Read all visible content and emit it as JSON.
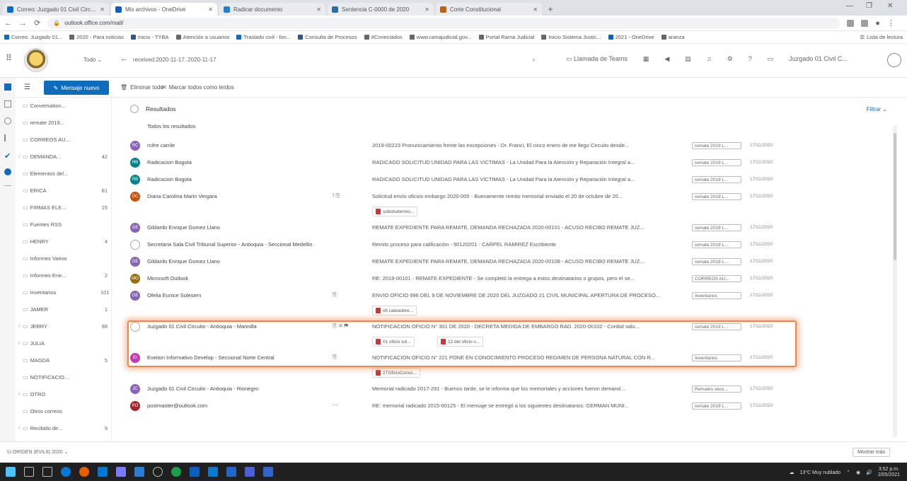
{
  "browser": {
    "tabs": [
      {
        "label": "Correo: Juzgado 01 Civil Circuito - A",
        "color": "#0f6cbd",
        "active": false
      },
      {
        "label": "Mis archivos - OneDrive",
        "color": "#0a5fbf",
        "active": true
      },
      {
        "label": "Radicar documento",
        "color": "#2b7cd3",
        "active": false
      },
      {
        "label": "Sentencia C-0000 de 2020",
        "color": "#2b6cb0",
        "active": false
      },
      {
        "label": "Corte Constitucional",
        "color": "#b5651d",
        "active": false
      }
    ],
    "new_tab": "+",
    "url": "outlook.office.com/mail/",
    "bookmarks": [
      {
        "label": "Correo: Juzgado 01...",
        "color": "#0f6cbd"
      },
      {
        "label": "2020 - Para noticias",
        "color": "#666666"
      },
      {
        "label": "Inicio - TYBA",
        "color": "#2b579a"
      },
      {
        "label": "Atención a usuarios",
        "color": "#666666"
      },
      {
        "label": "Traslado civil - fon...",
        "color": "#0f6cbd"
      },
      {
        "label": "Consulta de Procesos",
        "color": "#2b579a"
      },
      {
        "label": "#Conectados",
        "color": "#666666"
      },
      {
        "label": "www.ramajudicial.gov...",
        "color": "#666666"
      },
      {
        "label": "Portal Rama Judicial",
        "color": "#666666"
      },
      {
        "label": "Inicio Sistema Justic...",
        "color": "#666666"
      },
      {
        "label": "2021 - OneDrive",
        "color": "#0a5fbf"
      },
      {
        "label": "aranza",
        "color": "#666666"
      }
    ],
    "reading_list": "Lista de lectura"
  },
  "outlook": {
    "scope_label": "Todo",
    "search_query": "received:2020-11-17..2020-11-17",
    "toolbar_right": [
      "Llamada de Teams"
    ],
    "account_name": "Juzgado 01 Civil C...",
    "new_message_label": "Mensaje nuevo",
    "delete_all": "Eliminar todo",
    "mark_all_read": "Marcar todos como leídos",
    "folders": [
      {
        "name": "Conversation...",
        "count": "",
        "expanded": false
      },
      {
        "name": "remate 2019...",
        "count": "",
        "expanded": false
      },
      {
        "name": "CORREOS AU...",
        "count": "",
        "expanded": false
      },
      {
        "name": "DEMANDA...",
        "count": "42",
        "expanded": true
      },
      {
        "name": "Elementos del...",
        "count": "",
        "expanded": false
      },
      {
        "name": "ERICA",
        "count": "81",
        "expanded": false
      },
      {
        "name": "FIRMAS ELE...",
        "count": "15",
        "expanded": false
      },
      {
        "name": "Fuentes RSS",
        "count": "",
        "expanded": false
      },
      {
        "name": "HENRY",
        "count": "4",
        "expanded": false
      },
      {
        "name": "Informes Varios",
        "count": "",
        "expanded": false
      },
      {
        "name": "Informes Ene...",
        "count": "2",
        "expanded": false
      },
      {
        "name": "Inventarios",
        "count": "101",
        "expanded": false
      },
      {
        "name": "JAMER",
        "count": "1",
        "expanded": false
      },
      {
        "name": "JERRY",
        "count": "98",
        "expanded": true
      },
      {
        "name": "JULIA",
        "count": "",
        "expanded": true
      },
      {
        "name": "MAGDA",
        "count": "5",
        "expanded": false
      },
      {
        "name": "NOTIFICACIO...",
        "count": "",
        "expanded": false
      },
      {
        "name": "OTRO",
        "count": "",
        "expanded": true
      },
      {
        "name": "Otros correos",
        "count": "",
        "expanded": false
      },
      {
        "name": "Recibido de...",
        "count": "9",
        "expanded": true
      }
    ],
    "results_title": "Resultados",
    "filter_label": "Filtrar",
    "all_results_label": "Todos los resultados",
    "messages": [
      {
        "sender": "rcifre carrile",
        "avatar": "RC",
        "color": "#8764b8",
        "subject": "2019-00223 Pronunciamiento frente las excepciones - Dr. Franci, El cinco enero de me llego Circuito desde...",
        "folder": "remate 2019 L...",
        "date": "17/11/2020",
        "icons": "",
        "attachments": []
      },
      {
        "sender": "Radicacion Bogota",
        "avatar": "RB",
        "color": "#038387",
        "subject": "RADICADO SOLICITUD UNIDAD PARA LAS VICTIMAS - La Unidad Para la Atención y Reparación Integral a...",
        "folder": "remate 2019 L...",
        "date": "17/11/2020",
        "icons": "",
        "attachments": []
      },
      {
        "sender": "Radicacion Bogota",
        "avatar": "RB",
        "color": "#038387",
        "subject": "RADICADO SOLICITUD UNIDAD PARA LAS VICTIMAS - La Unidad Para la Atención y Reparación Integral a...",
        "folder": "remate 2019 L...",
        "date": "17/11/2020",
        "icons": "",
        "attachments": []
      },
      {
        "sender": "Diana Carolina Marin Vergara",
        "avatar": "DC",
        "color": "#ca5010",
        "subject": "Solicitud envío oficios embargo 2020-005 - Buenamente remito memorial enviado el 20 de octubre de 20...",
        "folder": "remate 2019 L...",
        "date": "17/11/2020",
        "icons": "! ⎘",
        "attachments": [
          "solicitudenvio..."
        ]
      },
      {
        "sender": "Gildardo Enrique Gomez Llano",
        "avatar": "GE",
        "color": "#8764b8",
        "subject": "REMATE EXPEDIENTE PARA REMATE, DEMANDA RECHAZADA 2020-00101 - ACUSO RECIBO REMATE JUZ...",
        "folder": "remate 2019 L...",
        "date": "17/11/2020",
        "icons": "",
        "attachments": []
      },
      {
        "sender": "Secretaria Sala Civil Tribunal Superior - Antioquia - Seccional Medellin",
        "avatar": "",
        "color": "#ffffff",
        "subject": "Remito proceso para calificación - 90120201 - CARPEL RAMIREZ Escribiente",
        "folder": "remate 2019 L...",
        "date": "17/11/2020",
        "icons": "",
        "attachments": []
      },
      {
        "sender": "Gildardo Enrique Gomez Llano",
        "avatar": "GE",
        "color": "#8764b8",
        "subject": "REMATE EXPEDIENTE PARA REMATE, DEMANDA RECHAZADA 2020-00108 - ACUSO RECIBO REMATE JUZ...",
        "folder": "remate 2019 L...",
        "date": "17/11/2020",
        "icons": "",
        "attachments": []
      },
      {
        "sender": "Microsoft Outlook",
        "avatar": "MO",
        "color": "#986f0b",
        "subject": "RE: 2018-00101 - REMATE EXPEDIENTE - Se completó la entrega a estos destinatarios o grupos, pero el se...",
        "folder": "CORREOS AU...",
        "date": "17/11/2020",
        "icons": "",
        "attachments": []
      },
      {
        "sender": "Ofelia Eunice Solesern",
        "avatar": "OE",
        "color": "#8764b8",
        "subject": "ENVIO OFICIO 996 DEL 9 DE NOVIEMBRE DE 2020 DEL JUZGADO 21 CIVIL MUNICIPAL APERTURA DE PROCESO...",
        "folder": "Inventarios",
        "date": "17/11/2020",
        "icons": "⎘",
        "attachments": [
          "ofi.cateaobre..."
        ]
      },
      {
        "sender": "Juzgado 01 Civil Circuito - Antioquia - Marinilla",
        "avatar": "",
        "color": "#ffffff",
        "subject": "NOTIFICACION OFICIO N° 301 DE 2020 - DECRETA MEDIDA DE EMBARGO RAD. 2020-00102 - Cordial salu...",
        "folder": "remate 2019 L...",
        "date": "17/11/2020",
        "icons": "⎘ ✉ ⚑ ⋯",
        "attachments": [
          "01 oficio sol...",
          "12 del oficio s..."
        ]
      },
      {
        "sender": "Eveiton Informativo Develop - Seccional Norte Central",
        "avatar": "EI",
        "color": "#c239b3",
        "subject": "NOTIFICACION OFICIO N° 221 PONE EN CONOCIMIENTO PROCESO REGIMEN DE PERSONA NATURAL CON R...",
        "folder": "Inventarios",
        "date": "17/11/2020",
        "icons": "⎘",
        "attachments": [
          "2TOficioConoc..."
        ]
      },
      {
        "sender": "Juzgado 01 Civil Circuito - Antioquia - Rionegro",
        "avatar": "JC",
        "color": "#8764b8",
        "subject": "Memorial radicado 2017-291 - Buenos tarde, se le informa que los memoriales y acciones fueron demand...",
        "folder": "Remates secu...",
        "date": "17/11/2020",
        "icons": "",
        "attachments": []
      },
      {
        "sender": "postmaster@outlook.com",
        "avatar": "PO",
        "color": "#a4262c",
        "subject": "RE: memorial radicado 2015-00125 - El mensaje se entregó a los siguientes destinatarios: GERMAN MUNI...",
        "folder": "remate 2019 L...",
        "date": "17/11/2020",
        "icons": "⋯",
        "attachments": []
      }
    ],
    "storage_text": "ORIGEN (EVIL8) 2020",
    "show_more": "Mostrar más"
  },
  "taskbar": {
    "weather": "13°C Muy nublado",
    "time": "3:52 p.m.",
    "date": "2/05/2021"
  }
}
